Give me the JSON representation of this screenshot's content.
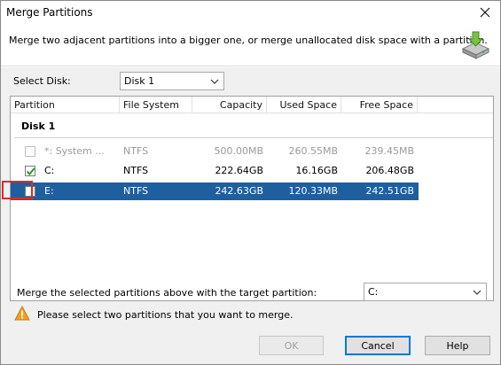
{
  "window": {
    "title": "Merge Partitions"
  },
  "header": {
    "description": "Merge two adjacent partitions into a bigger one, or merge unallocated disk space with a partition."
  },
  "select_disk": {
    "label": "Select Disk:",
    "value": "Disk 1"
  },
  "table": {
    "columns": [
      "Partition",
      "File System",
      "Capacity",
      "Used Space",
      "Free Space"
    ],
    "group": "Disk 1",
    "rows": [
      {
        "partition": "*: System ...",
        "fs": "NTFS",
        "capacity": "500.00MB",
        "used": "260.55MB",
        "free": "239.45MB",
        "checked": false,
        "state": "disabled"
      },
      {
        "partition": "C:",
        "fs": "NTFS",
        "capacity": "222.64GB",
        "used": "16.16GB",
        "free": "206.48GB",
        "checked": true,
        "state": "normal"
      },
      {
        "partition": "E:",
        "fs": "NTFS",
        "capacity": "242.63GB",
        "used": "120.33MB",
        "free": "242.51GB",
        "checked": false,
        "state": "selected"
      }
    ]
  },
  "merge": {
    "label": "Merge the selected partitions above with the target partition:",
    "target_value": "C:"
  },
  "warning": {
    "text": "Please select two partitions that you want to merge."
  },
  "buttons": {
    "ok": "OK",
    "cancel": "Cancel",
    "help": "Help"
  },
  "colors": {
    "selection": "#1e5f9f",
    "highlight_border": "#d92b2b",
    "checkbox_check": "#2f8f2f",
    "warning": "#f0a020"
  }
}
